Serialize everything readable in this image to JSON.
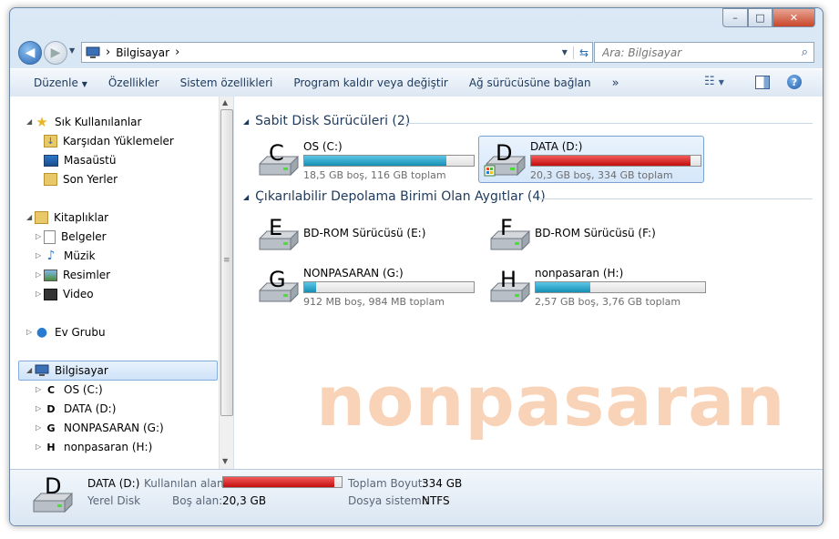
{
  "window_controls": {
    "minimize": "–",
    "maximize": "□",
    "close": "✕"
  },
  "address": {
    "path_root": "Bilgisayar",
    "sep": "›"
  },
  "search": {
    "placeholder": "Ara: Bilgisayar"
  },
  "toolbar": {
    "items": [
      "Düzenle",
      "Özellikler",
      "Sistem özellikleri",
      "Program kaldır veya değiştir",
      "Ağ sürücüsüne bağlan"
    ],
    "more": "»"
  },
  "nav": {
    "favorites": {
      "label": "Sık Kullanılanlar",
      "items": [
        "Karşıdan Yüklemeler",
        "Masaüstü",
        "Son Yerler"
      ]
    },
    "libraries": {
      "label": "Kitaplıklar",
      "items": [
        "Belgeler",
        "Müzik",
        "Resimler",
        "Video"
      ]
    },
    "homegroup": {
      "label": "Ev Grubu"
    },
    "computer": {
      "label": "Bilgisayar",
      "items": [
        "OS (C:)",
        "DATA (D:)",
        "NONPASARAN (G:)",
        "nonpasaran (H:)"
      ],
      "letters": [
        "C",
        "D",
        "G",
        "H"
      ]
    }
  },
  "groups": {
    "hdd": "Sabit Disk Sürücüleri (2)",
    "removable": "Çıkarılabilir Depolama Birimi Olan Aygıtlar (4)"
  },
  "drives": [
    {
      "letter": "C",
      "name": "OS (C:)",
      "free": "18,5 GB boş, 116 GB toplam",
      "used_fraction": 0.84,
      "bar_color": "#1c9fc8"
    },
    {
      "letter": "D",
      "name": "DATA (D:)",
      "free": "20,3 GB boş, 334 GB toplam",
      "used_fraction": 0.94,
      "bar_color": "#d81b1b"
    },
    {
      "letter": "E",
      "name": "BD-ROM Sürücüsü (E:)"
    },
    {
      "letter": "F",
      "name": "BD-ROM Sürücüsü (F:)"
    },
    {
      "letter": "G",
      "name": "NONPASARAN (G:)",
      "free": "912 MB boş, 984 MB toplam",
      "used_fraction": 0.07,
      "bar_color": "#1c9fc8"
    },
    {
      "letter": "H",
      "name": "nonpasaran (H:)",
      "free": "2,57 GB boş, 3,76 GB toplam",
      "used_fraction": 0.32,
      "bar_color": "#1c9fc8"
    }
  ],
  "watermark": "nonpasaran",
  "details": {
    "letter": "D",
    "name": "DATA (D:)",
    "type": "Yerel Disk",
    "used_label": "Kullanılan alan:",
    "used_fraction": 0.94,
    "free_label": "Boş alan:",
    "free_value": "20,3 GB",
    "total_label": "Toplam Boyut:",
    "total_value": "334 GB",
    "fs_label": "Dosya sistemi:",
    "fs_value": "NTFS"
  }
}
